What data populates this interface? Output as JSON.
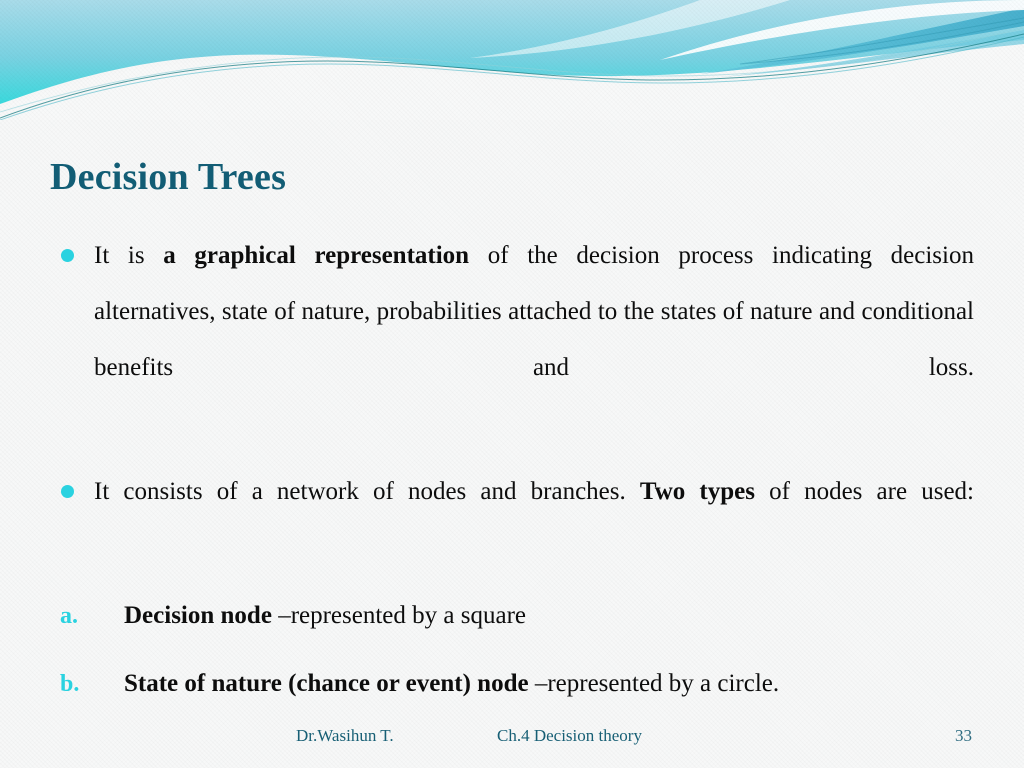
{
  "slide": {
    "title": "Decision Trees",
    "accent_color": "#2ad2e0",
    "title_color": "#125d75",
    "banner_top_color": "#a8dce9",
    "banner_bottom_color": "#3ddbe0",
    "background_color": "#f7f8f8"
  },
  "bullets": [
    {
      "icon": "round-bullet-icon",
      "segments": [
        {
          "text": "It is ",
          "bold": false
        },
        {
          "text": "a graphical representation",
          "bold": true
        },
        {
          "text": " of the decision process indicating decision alternatives, state of nature, probabilities attached to the states of nature and conditional benefits and loss.",
          "bold": false
        }
      ]
    },
    {
      "icon": "round-bullet-icon",
      "segments": [
        {
          "text": "It consists of a network of nodes and branches. ",
          "bold": false
        },
        {
          "text": "Two types",
          "bold": true
        },
        {
          "text": " of nodes are used:",
          "bold": false
        }
      ]
    }
  ],
  "lettered_items": [
    {
      "marker": "a.",
      "segments": [
        {
          "text": "Decision node ",
          "bold": true
        },
        {
          "text": "–represented by a square",
          "bold": false
        }
      ]
    },
    {
      "marker": "b.",
      "segments": [
        {
          "text": "State of nature (chance or event) node ",
          "bold": true
        },
        {
          "text": "–represented by a circle.",
          "bold": false
        }
      ]
    }
  ],
  "footer": {
    "author": "Dr.Wasihun T.",
    "chapter": "Ch.4 Decision theory",
    "page_number": "33"
  }
}
